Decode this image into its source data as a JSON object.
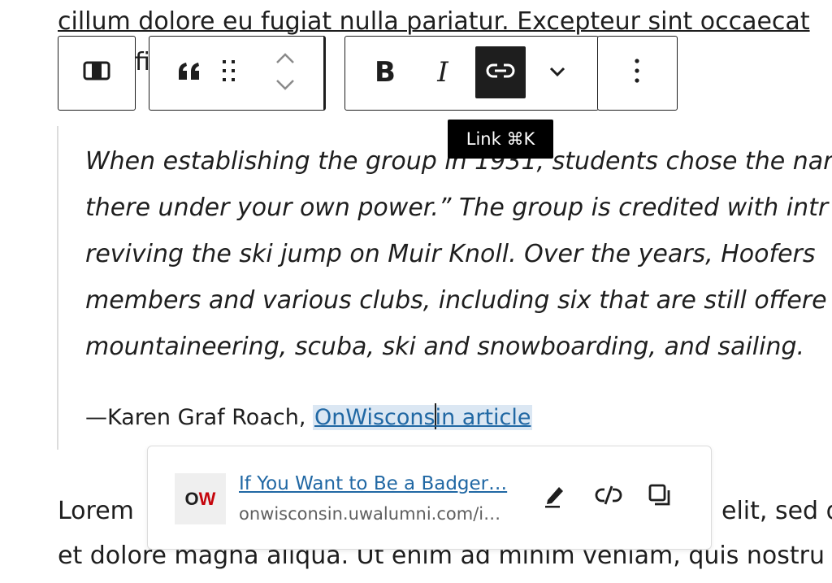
{
  "paragraph_top": {
    "text": "cillum dolore eu fugiat nulla pariatur. Excepteur sint occaecat"
  },
  "paragraph_partial": {
    "text": "fi"
  },
  "toolbar": {
    "bold_label": "B",
    "italic_label": "I",
    "tooltip": "Link ⌘K",
    "icons": [
      "block-type-icon",
      "quote-icon",
      "drag-handle-icon",
      "move-up-icon",
      "move-down-icon",
      "bold-icon",
      "italic-icon",
      "link-icon",
      "chevron-down-icon",
      "more-options-icon"
    ]
  },
  "quote": {
    "lines": [
      "When establishing the group in 1931, students chose the nar",
      "there under your own power.” The group is credited with intr",
      "reviving the ski jump on Muir Knoll. Over the years, Hoofers",
      "members and various clubs, including six that are still offere",
      "mountaineering, scuba, ski and snowboarding, and sailing."
    ],
    "citation_prefix": "—Karen Graf Roach, ",
    "citation_link_a": "OnWiscons",
    "citation_link_b": "in article"
  },
  "link_popover": {
    "favicon_o": "O",
    "favicon_w": "W",
    "title": "If You Want to Be a Badger…",
    "url": "onwisconsin.uwalumni.com/i…",
    "icons": [
      "edit-icon",
      "unlink-icon",
      "copy-icon"
    ]
  },
  "paragraph_bottom": {
    "line1_left": "Lorem",
    "line1_right": "elit, sed d",
    "line2": "et dolore magna aliqua. Ut enim ad minim veniam, quis nostru"
  },
  "colors": {
    "accent": "#2168a4",
    "dark": "#1e1e1e",
    "highlight": "#dbe7f3",
    "favicon_red": "#c5050c"
  }
}
